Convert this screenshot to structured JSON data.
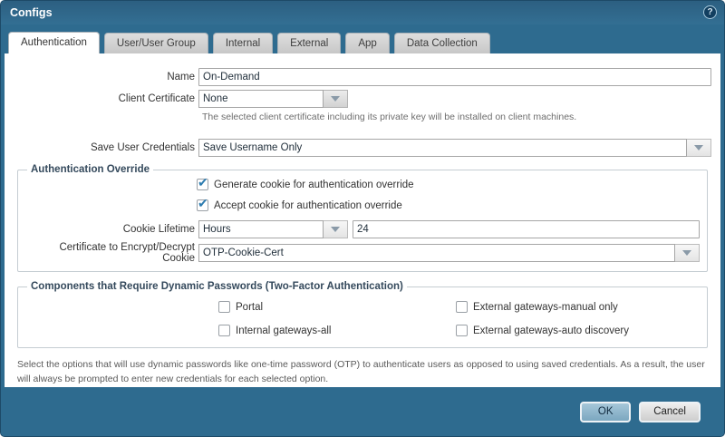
{
  "dialog": {
    "title": "Configs",
    "help_glyph": "?"
  },
  "tabs": [
    {
      "label": "Authentication",
      "active": true
    },
    {
      "label": "User/User Group",
      "active": false
    },
    {
      "label": "Internal",
      "active": false
    },
    {
      "label": "External",
      "active": false
    },
    {
      "label": "App",
      "active": false
    },
    {
      "label": "Data Collection",
      "active": false
    }
  ],
  "form": {
    "name": {
      "label": "Name",
      "value": "On-Demand"
    },
    "client_certificate": {
      "label": "Client Certificate",
      "value": "None",
      "help": "The selected client certificate including its private key will be installed on client machines."
    },
    "save_user_credentials": {
      "label": "Save User Credentials",
      "value": "Save Username Only"
    }
  },
  "auth_override": {
    "legend": "Authentication Override",
    "generate_cookie": {
      "label": "Generate cookie for authentication override",
      "checked": true
    },
    "accept_cookie": {
      "label": "Accept cookie for authentication override",
      "checked": true
    },
    "cookie_lifetime": {
      "label": "Cookie Lifetime",
      "unit": "Hours",
      "value": "24"
    },
    "cookie_cert": {
      "label": "Certificate to Encrypt/Decrypt Cookie",
      "value": "OTP-Cookie-Cert"
    }
  },
  "components": {
    "legend": "Components that Require Dynamic Passwords (Two-Factor Authentication)",
    "options": [
      {
        "label": "Portal",
        "checked": false
      },
      {
        "label": "Internal gateways-all",
        "checked": false
      },
      {
        "label": "External gateways-manual only",
        "checked": false
      },
      {
        "label": "External gateways-auto discovery",
        "checked": false
      }
    ]
  },
  "note": "Select the options that will use dynamic passwords like one-time password (OTP) to authenticate users as opposed to using saved credentials. As a result, the user will always be prompted to enter new credentials for each selected option.",
  "footer": {
    "ok_label": "OK",
    "cancel_label": "Cancel"
  },
  "colors": {
    "header": "#2e6b8f",
    "check": "#2e7cb0",
    "active_tab_bg": "#ffffff"
  }
}
